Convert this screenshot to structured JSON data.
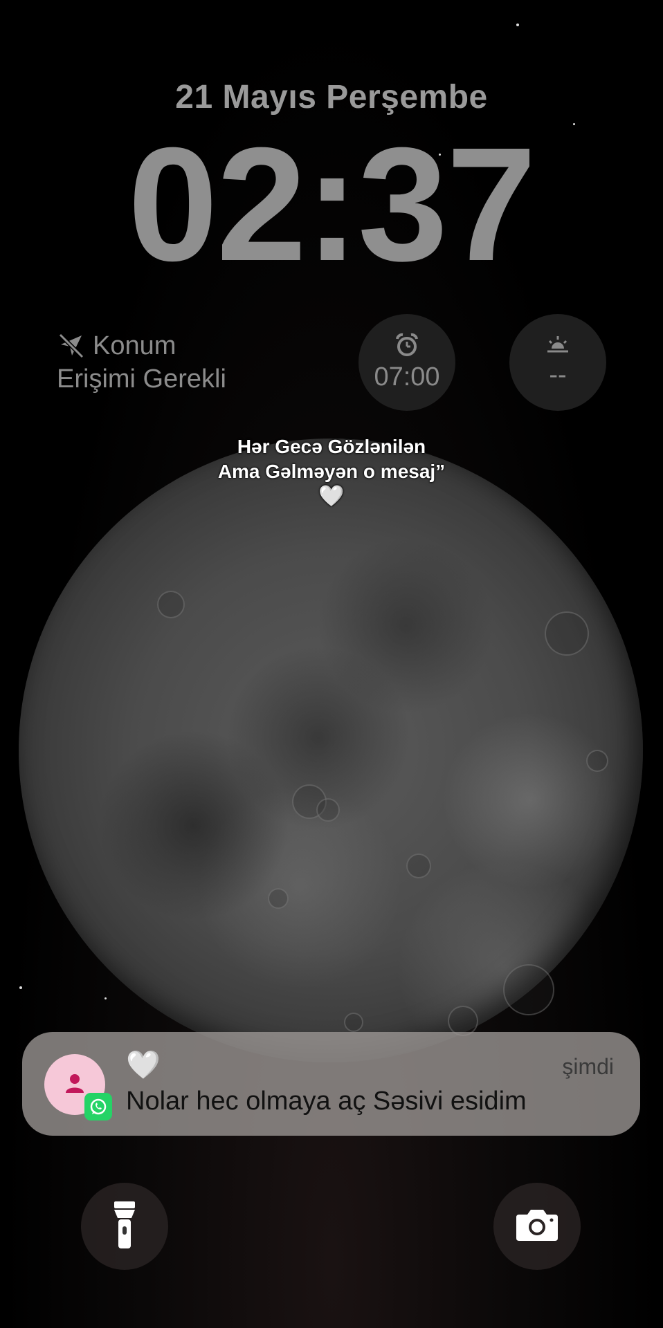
{
  "lockscreen": {
    "date": "21 Mayıs Perşembe",
    "time": "02:37"
  },
  "widgets": {
    "location": {
      "icon": "location-slash-icon",
      "line1": "Konum",
      "line2": "Erişimi Gerekli"
    },
    "alarm": {
      "icon": "alarm-clock-icon",
      "value": "07:00"
    },
    "sunrise": {
      "icon": "sunrise-icon",
      "value": "--"
    }
  },
  "caption": {
    "line1": "Hər Gecə Gözlənilən",
    "line2": "Ama Gəlməyən o mesaj”",
    "heart": "🤍"
  },
  "notification": {
    "app_icon": "whatsapp-icon",
    "avatar_icon": "person-icon",
    "title": "🤍",
    "time": "şimdi",
    "body": "Nolar hec olmaya aç Səsivi esidim"
  },
  "quick_actions": {
    "left_icon": "flashlight-icon",
    "right_icon": "camera-icon"
  },
  "colors": {
    "background": "#000000",
    "avatar_bg": "#f6c8d8",
    "avatar_fg": "#c2185b",
    "whatsapp_green": "#25d366"
  }
}
